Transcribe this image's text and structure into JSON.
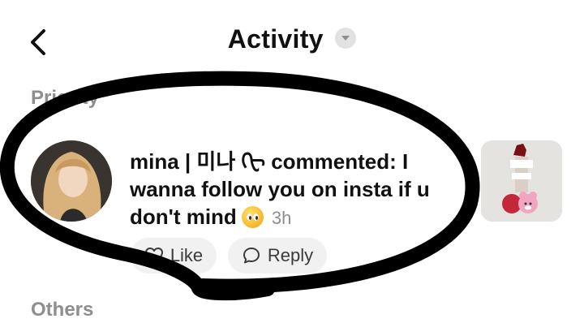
{
  "header": {
    "title": "Activity",
    "back_icon": "chevron-left-icon",
    "dropdown_icon": "chevron-down-icon"
  },
  "sections": {
    "priority_label": "Priority",
    "others_label": "Others"
  },
  "notification": {
    "text": "mina | 미나 ᠬᠧ commented: I wanna follow you on insta if u don't mind",
    "emoji": "pleading-face",
    "time": "3h",
    "actions": {
      "like_label": "Like",
      "reply_label": "Reply"
    }
  },
  "colors": {
    "title": "#111111",
    "muted": "#8e8e8e",
    "pill_background": "#f1f1f1",
    "marker": "#000000"
  }
}
